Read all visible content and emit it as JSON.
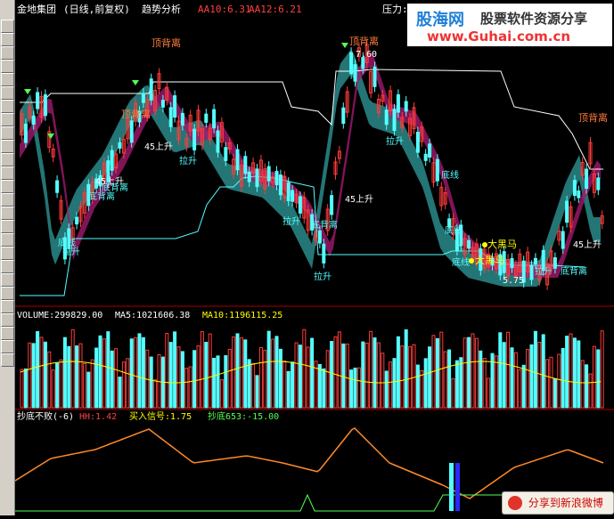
{
  "header": {
    "stock_name": "金地集团",
    "period": "(日线,前复权)",
    "indicator": "趋势分析",
    "aa10": "AA10:6.31",
    "aa12": "AA12:6.21",
    "pressure": "压力:6"
  },
  "watermark": {
    "brand": "股海网",
    "slogan": "股票软件资源分享",
    "url": "www.Guhai.com.cn"
  },
  "price_panel": {
    "labels": {
      "top_divergence": "顶背离",
      "bottom_divergence": "底背离",
      "rise45": "45上升",
      "pull_up": "拉升",
      "big_black_horse": "大黑马",
      "bottom_line": "底线"
    },
    "price_high": "7.60",
    "price_low": "5.75"
  },
  "volume_panel": {
    "volume": "VOLUME:299829.00",
    "ma5": "MA5:1021606.38",
    "ma10": "MA10:1196115.25"
  },
  "indicator_panel": {
    "name": "抄底不败(-6)",
    "hh": "HH:1.42",
    "buy_signal": "买入信号:1.75",
    "chaodi": "抄底653:-15.00"
  },
  "share": {
    "label": "分享到新浪微博"
  },
  "colors": {
    "up": "#ff3b3b",
    "down": "#54ffff",
    "magenta_band": "#a0196e",
    "teal_band": "#2a8a8a",
    "title": "#ffffff",
    "aa10": "#ff4040",
    "aa12": "#ff4040",
    "yellow": "#ffff00"
  }
}
